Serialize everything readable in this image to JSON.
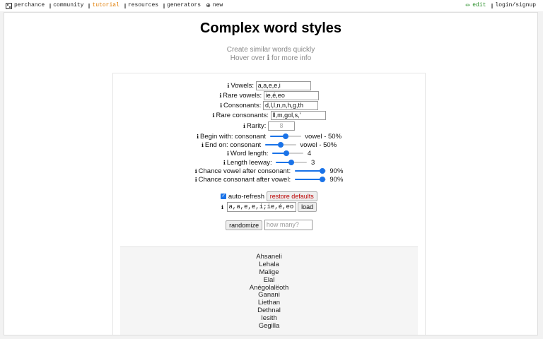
{
  "topbar": {
    "left": [
      {
        "label": "perchance",
        "icon": "dice-logo-icon"
      },
      {
        "label": "community",
        "icon": "bar-icon"
      },
      {
        "label": "tutorial",
        "icon": "bar-icon",
        "active": true
      },
      {
        "label": "resources",
        "icon": "bar-icon"
      },
      {
        "label": "generators",
        "icon": "bar-icon"
      },
      {
        "label": "new",
        "icon": "plus-circle-icon",
        "glyph": "⊕"
      }
    ],
    "edit": {
      "label": "edit",
      "glyph": "✏"
    },
    "login": {
      "label": "login/signup"
    }
  },
  "header": {
    "title": "Complex word styles",
    "subtitle1": "Create similar words quickly",
    "subtitle2": "Hover over ℹ for more info"
  },
  "form": {
    "info_glyph": "ℹ",
    "vowels": {
      "label": "Vowels:",
      "value": "a,a,e,e,i"
    },
    "rare_vowels": {
      "label": "Rare vowels:",
      "value": "ie,é,eo"
    },
    "consonants": {
      "label": "Consonants:",
      "value": "d,l,l,n,n,h,g,th"
    },
    "rare_consonants": {
      "label": "Rare consonants:",
      "value": "ll,m,gol,s,'"
    },
    "rarity": {
      "label": "Rarity:",
      "placeholder": "8"
    },
    "begin_with": {
      "label": "Begin with: consonant",
      "after": "vowel - 50%",
      "fraction": 0.5
    },
    "end_on": {
      "label": "End on: consonant",
      "after": "vowel - 50%",
      "fraction": 0.5
    },
    "word_length": {
      "label": "Word length:",
      "value": "4",
      "fraction": 0.45
    },
    "length_leeway": {
      "label": "Length leeway:",
      "value": "3",
      "fraction": 0.5
    },
    "chance_vowel": {
      "label": "Chance vowel after consonant:",
      "value": "90%",
      "fraction": 0.9
    },
    "chance_consonant": {
      "label": "Chance consonant after vowel:",
      "value": "90%",
      "fraction": 0.9
    },
    "auto_refresh": {
      "label": "auto-refresh",
      "checked": true
    },
    "restore_label": "restore defaults",
    "load_value": "a,a,e,e,i;ie,é,eo",
    "load_label": "load",
    "randomize_label": "randomize",
    "howmany_placeholder": "how many?"
  },
  "output": {
    "words": [
      "Ahsaneli",
      "Lehala",
      "Malige",
      "Elal",
      "Anégolalëoth",
      "Ganani",
      "Liethan",
      "Dethnal",
      "Iesith",
      "Gegilla"
    ]
  },
  "colors": {
    "accent": "#1a73e8",
    "active_nav": "#e07b00",
    "edit": "#2a8f2a",
    "restore": "#b00000"
  }
}
